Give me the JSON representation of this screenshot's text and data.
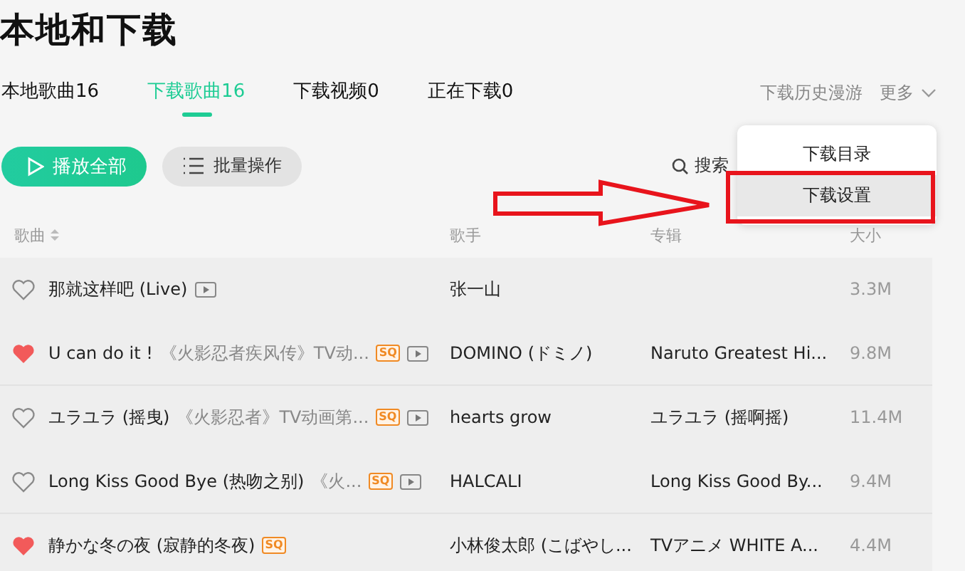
{
  "title": "本地和下载",
  "tabs": [
    {
      "label": "本地歌曲16",
      "selected": false
    },
    {
      "label": "下载歌曲16",
      "selected": true
    },
    {
      "label": "下载视频0",
      "selected": false
    },
    {
      "label": "正在下载0",
      "selected": false
    }
  ],
  "top_links": {
    "history": "下载历史漫游",
    "more": "更多"
  },
  "toolbar": {
    "play_all": "播放全部",
    "batch": "批量操作",
    "search": "搜索"
  },
  "table": {
    "columns": [
      "歌曲",
      "歌手",
      "专辑",
      "大小"
    ],
    "rows": [
      {
        "liked": false,
        "song": {
          "title": "那就这样吧 (Live)",
          "badges": [
            {
              "kind": "video"
            }
          ]
        },
        "singer": "张一山",
        "album": "",
        "size": "3.3M"
      },
      {
        "liked": true,
        "song": {
          "title": "U can do it !",
          "subtitle": "《火影忍者疾风传》TV动...",
          "badges": [
            {
              "kind": "quality",
              "label": "SQ"
            },
            {
              "kind": "video"
            }
          ]
        },
        "singer": "DOMINO (ドミノ)",
        "album": "Naruto Greatest Hi...",
        "size": "9.8M"
      },
      {
        "liked": false,
        "song": {
          "title": "ユラユラ (摇曳)",
          "subtitle": "《火影忍者》TV动画第...",
          "badges": [
            {
              "kind": "quality",
              "label": "SQ"
            },
            {
              "kind": "video"
            }
          ]
        },
        "singer": "hearts grow",
        "album": "ユラユラ (摇啊摇)",
        "size": "11.4M"
      },
      {
        "liked": false,
        "song": {
          "title": "Long Kiss Good Bye (热吻之别)",
          "subtitle": "《火...",
          "badges": [
            {
              "kind": "quality",
              "label": "SQ"
            },
            {
              "kind": "video"
            }
          ]
        },
        "singer": "HALCALI",
        "album": "Long Kiss Good By...",
        "size": "9.4M"
      },
      {
        "liked": true,
        "song": {
          "title": "静かな冬の夜 (寂静的冬夜)",
          "badges": [
            {
              "kind": "quality",
              "label": "SQ"
            }
          ]
        },
        "singer": "小林俊太郎 (こばやし...",
        "album": "TVアニメ WHITE A...",
        "size": "4.4M"
      }
    ]
  },
  "menu": {
    "items": [
      {
        "label": "下载目录",
        "selected": false
      },
      {
        "label": "下载设置",
        "selected": true
      }
    ]
  }
}
